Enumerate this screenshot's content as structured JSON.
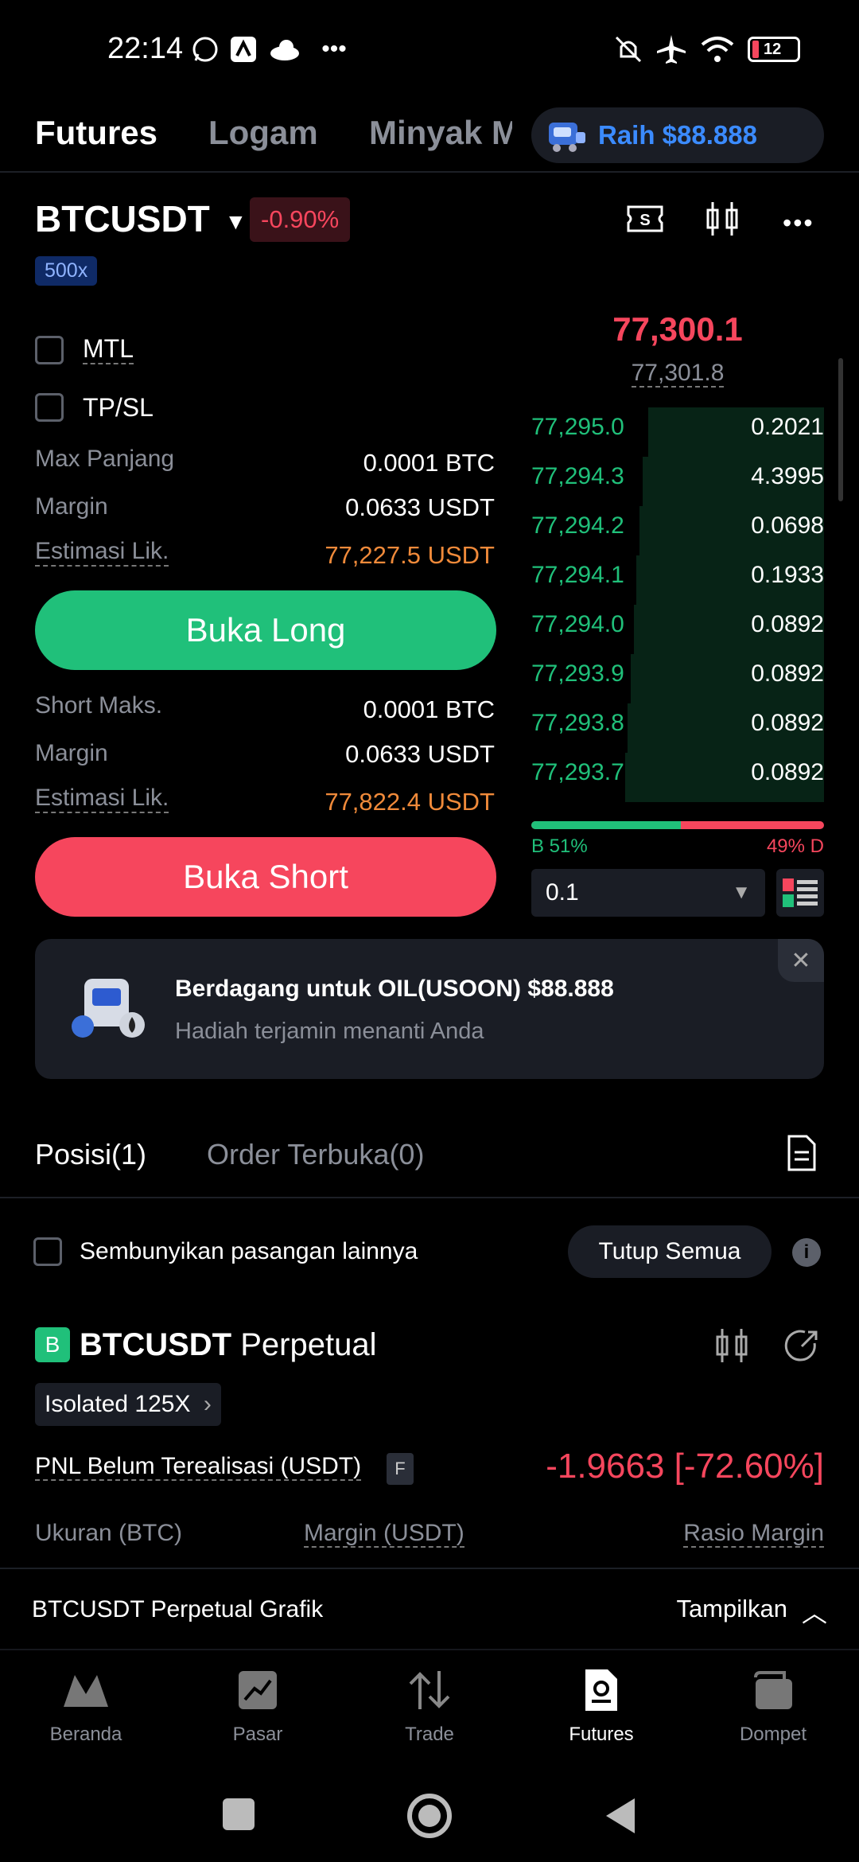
{
  "status": {
    "time": "22:14",
    "battery": "12"
  },
  "topnav": {
    "tabs": [
      "Futures",
      "Logam",
      "Minyak M"
    ],
    "promo_label": "Raih $88.888"
  },
  "header": {
    "symbol": "BTCUSDT",
    "change": "-0.90%",
    "leverage": "500x"
  },
  "form": {
    "mtl_label": "MTL",
    "tpsl_label": "TP/SL",
    "long": {
      "max_label": "Max Panjang",
      "max_value": "0.0001 BTC",
      "margin_label": "Margin",
      "margin_value": "0.0633 USDT",
      "liq_label": "Estimasi Lik.",
      "liq_value": "77,227.5 USDT",
      "button": "Buka Long"
    },
    "short": {
      "max_label": "Short Maks.",
      "max_value": "0.0001 BTC",
      "margin_label": "Margin",
      "margin_value": "0.0633 USDT",
      "liq_label": "Estimasi Lik.",
      "liq_value": "77,822.4 USDT",
      "button": "Buka Short"
    }
  },
  "orderbook": {
    "last_price": "77,300.1",
    "mark_price": "77,301.8",
    "rows": [
      {
        "price": "77,295.0",
        "qty": "0.2021",
        "depth": 0.6
      },
      {
        "price": "77,294.3",
        "qty": "4.3995",
        "depth": 0.62
      },
      {
        "price": "77,294.2",
        "qty": "0.0698",
        "depth": 0.63
      },
      {
        "price": "77,294.1",
        "qty": "0.1933",
        "depth": 0.64
      },
      {
        "price": "77,294.0",
        "qty": "0.0892",
        "depth": 0.65
      },
      {
        "price": "77,293.9",
        "qty": "0.0892",
        "depth": 0.66
      },
      {
        "price": "77,293.8",
        "qty": "0.0892",
        "depth": 0.67
      },
      {
        "price": "77,293.7",
        "qty": "0.0892",
        "depth": 0.68
      }
    ],
    "buy_pct": "B 51%",
    "sell_pct": "49% D",
    "buy_ratio": 0.51,
    "step_value": "0.1"
  },
  "promo_card": {
    "title": "Berdagang untuk OIL(USOON) $88.888",
    "subtitle": "Hadiah terjamin menanti Anda"
  },
  "positions": {
    "tab_positions": "Posisi(1)",
    "tab_orders": "Order Terbuka(0)",
    "hide_others": "Sembunyikan pasangan lainnya",
    "close_all": "Tutup Semua",
    "side_badge": "B",
    "symbol": "BTCUSDT",
    "contract": "Perpetual",
    "mode": "Isolated 125X",
    "pnl_label": "PNL Belum Terealisasi (USDT)",
    "pnl_flag": "F",
    "pnl_value": "-1.9663 [-72.60%]",
    "col_size": "Ukuran (BTC)",
    "col_margin": "Margin (USDT)",
    "col_ratio": "Rasio Margin"
  },
  "chart_banner": {
    "label": "BTCUSDT Perpetual Grafik",
    "action": "Tampilkan"
  },
  "bottomnav": [
    "Beranda",
    "Pasar",
    "Trade",
    "Futures",
    "Dompet"
  ],
  "colors": {
    "green": "#20c07a",
    "red": "#f6465d",
    "orange": "#f08a3a",
    "blue": "#3b8bff"
  }
}
